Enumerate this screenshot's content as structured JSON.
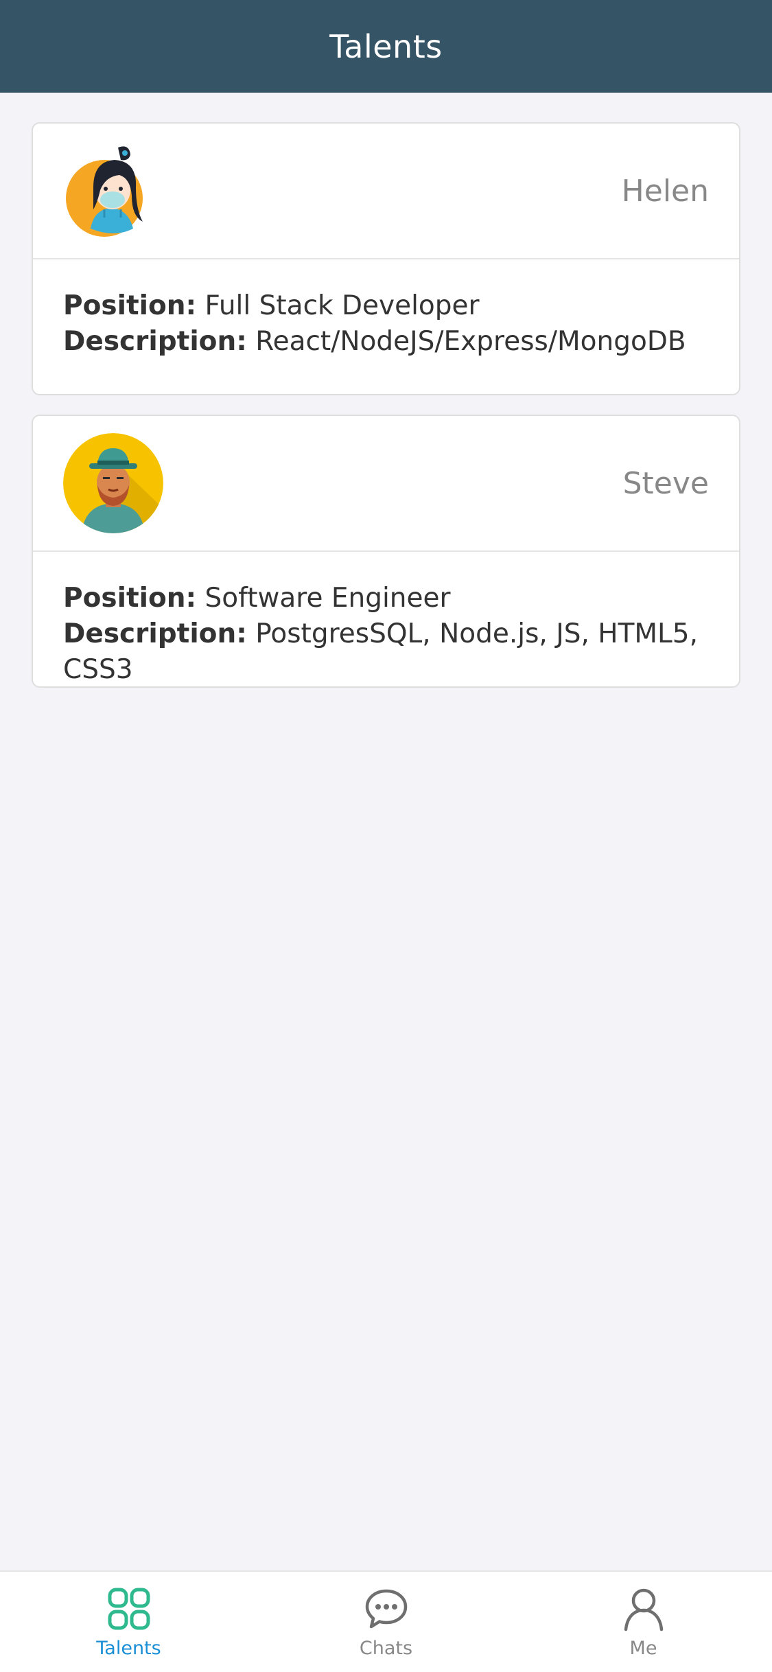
{
  "header": {
    "title": "Talents"
  },
  "talents": [
    {
      "name": "Helen",
      "avatar_icon": "female-avatar-icon",
      "position_label": "Position:",
      "position": "Full Stack Developer",
      "description_label": "Description:",
      "description": "React/NodeJS/Express/MongoDB"
    },
    {
      "name": "Steve",
      "avatar_icon": "male-avatar-icon",
      "position_label": "Position:",
      "position": "Software Engineer",
      "description_label": "Description:",
      "description": "PostgresSQL, Node.js, JS, HTML5, CSS3"
    }
  ],
  "tabbar": {
    "items": [
      {
        "label": "Talents",
        "icon": "grid-icon",
        "active": true
      },
      {
        "label": "Chats",
        "icon": "chat-bubble-icon",
        "active": false
      },
      {
        "label": "Me",
        "icon": "user-icon",
        "active": false
      }
    ]
  },
  "colors": {
    "header_bg": "#355466",
    "active_tab": "#1a8fd6",
    "active_icon": "#2eb98e",
    "background": "#f3f3f8"
  }
}
